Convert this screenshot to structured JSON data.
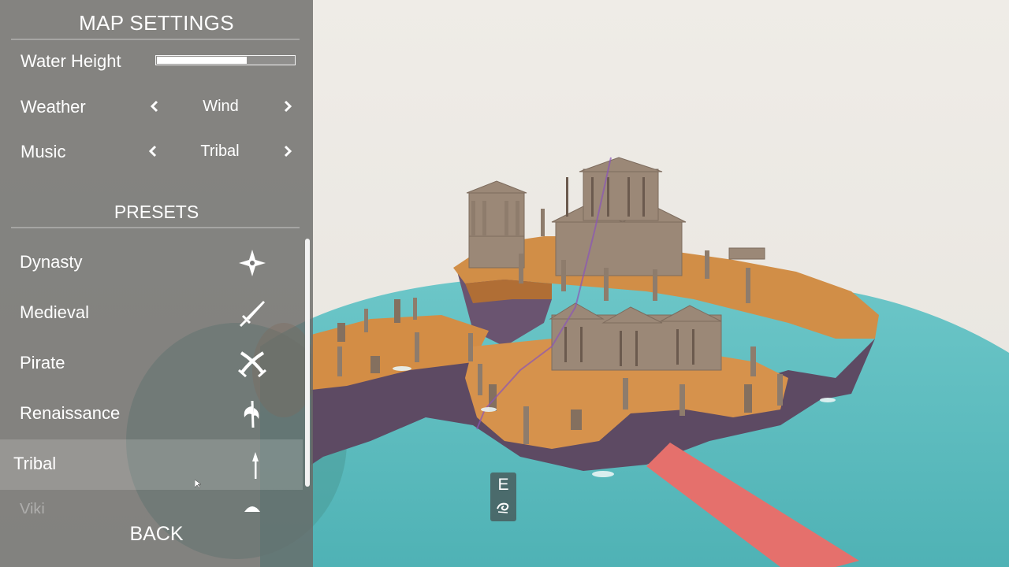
{
  "panel": {
    "title": "MAP SETTINGS",
    "settings": {
      "water_height": {
        "label": "Water Height",
        "value": 0.66
      },
      "weather": {
        "label": "Weather",
        "value": "Wind"
      },
      "music": {
        "label": "Music",
        "value": "Tribal"
      }
    },
    "presets_title": "PRESETS",
    "presets": [
      {
        "label": "Dynasty",
        "icon": "shuriken-icon"
      },
      {
        "label": "Medieval",
        "icon": "sword-icon"
      },
      {
        "label": "Pirate",
        "icon": "crossed-sabres-icon"
      },
      {
        "label": "Renaissance",
        "icon": "halberd-icon"
      },
      {
        "label": "Tribal",
        "icon": "spear-icon",
        "selected": true
      },
      {
        "label": "Viki",
        "icon": "viking-helmet-icon"
      }
    ],
    "back_label": "BACK"
  },
  "key_prompt": {
    "key": "E",
    "icon": "swirl-icon"
  },
  "colors": {
    "panel_bg": "#696967",
    "water": "#5fbdc0",
    "sand": "#d18e47",
    "stone": "#9a8776",
    "sky": "#ece9e3",
    "beam": "#e5706c"
  }
}
